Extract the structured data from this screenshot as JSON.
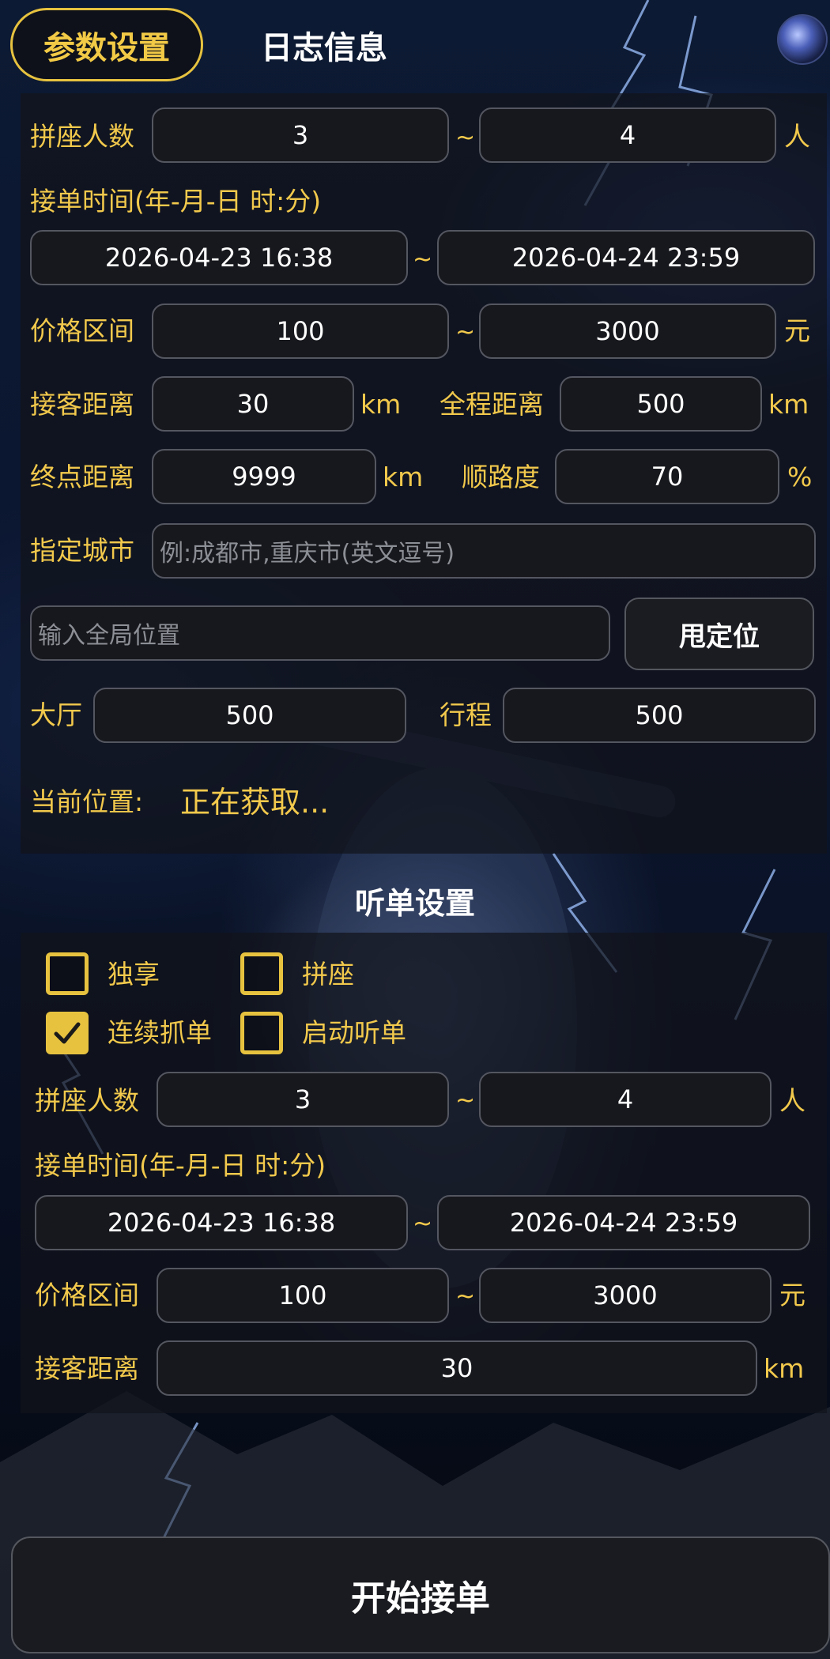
{
  "tabs": {
    "params": "参数设置",
    "log": "日志信息"
  },
  "params": {
    "seats_label": "拼座人数",
    "seats_min": "3",
    "seats_max": "4",
    "seats_unit": "人",
    "time_label": "接单时间(年-月-日 时:分)",
    "time_start": "2026-04-23 16:38",
    "time_end": "2026-04-24 23:59",
    "price_label": "价格区间",
    "price_min": "100",
    "price_max": "3000",
    "price_unit": "元",
    "pickup_label": "接客距离",
    "pickup_value": "30",
    "pickup_unit": "km",
    "total_label": "全程距离",
    "total_value": "500",
    "total_unit": "km",
    "dest_label": "终点距离",
    "dest_value": "9999",
    "dest_unit": "km",
    "route_label": "顺路度",
    "route_value": "70",
    "route_unit": "%",
    "city_label": "指定城市",
    "city_placeholder": "例:成都市,重庆市(英文逗号)",
    "location_placeholder": "输入全局位置",
    "locate_button": "甩定位",
    "hall_label": "大厅",
    "hall_value": "500",
    "trip_label": "行程",
    "trip_value": "500",
    "current_label": "当前位置:",
    "current_value": "正在获取..."
  },
  "tilde": "~",
  "listen": {
    "title": "听单设置",
    "options": [
      {
        "label": "独享",
        "checked": false
      },
      {
        "label": "拼座",
        "checked": false
      },
      {
        "label": "连续抓单",
        "checked": true
      },
      {
        "label": "启动听单",
        "checked": false
      }
    ],
    "seats_label": "拼座人数",
    "seats_min": "3",
    "seats_max": "4",
    "seats_unit": "人",
    "time_label": "接单时间(年-月-日 时:分)",
    "time_start": "2026-04-23 16:38",
    "time_end": "2026-04-24 23:59",
    "price_label": "价格区间",
    "price_min": "100",
    "price_max": "3000",
    "price_unit": "元",
    "pickup_label": "接客距离",
    "pickup_value": "30",
    "pickup_unit": "km"
  },
  "start_button": "开始接单",
  "colors": {
    "accent": "#f2c94c",
    "field_bg": "#17181d",
    "field_border": "#545660"
  },
  "icons": {
    "checkbox_checked": "checkmark-icon",
    "avatar": "avatar-icon"
  }
}
